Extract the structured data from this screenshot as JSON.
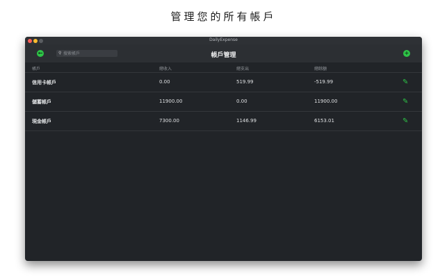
{
  "headline": "管理您的所有帳戶",
  "window": {
    "title": "DailyExpense"
  },
  "navbar": {
    "title": "帳戶管理",
    "search_placeholder": "搜索帳戶"
  },
  "table": {
    "columns": [
      "帳戶",
      "總收入",
      "總支出",
      "總餘額"
    ],
    "rows": [
      {
        "name": "信用卡帳戶",
        "income": "0.00",
        "expense": "519.99",
        "balance": "-519.99"
      },
      {
        "name": "儲蓄帳戶",
        "income": "11900.00",
        "expense": "0.00",
        "balance": "11900.00"
      },
      {
        "name": "現金帳戶",
        "income": "7300.00",
        "expense": "1146.99",
        "balance": "6153.01"
      }
    ]
  },
  "colors": {
    "accent": "#2ec447",
    "window_bg": "#212428"
  },
  "icons": {
    "back": "back-arrow-icon",
    "add": "plus-icon",
    "search": "search-icon",
    "edit": "pencil-icon"
  }
}
